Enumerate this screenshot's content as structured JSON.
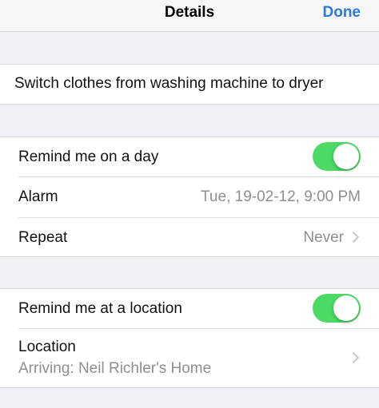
{
  "navbar": {
    "title": "Details",
    "done_label": "Done"
  },
  "task": {
    "title": "Switch clothes from washing machine to dryer"
  },
  "day_group": {
    "remind_day_label": "Remind me on a day",
    "remind_day_on": true,
    "alarm_label": "Alarm",
    "alarm_value": "Tue, 19-02-12, 9:00 PM",
    "repeat_label": "Repeat",
    "repeat_value": "Never"
  },
  "location_group": {
    "remind_location_label": "Remind me at a location",
    "remind_location_on": true,
    "location_label": "Location",
    "location_value": "Arriving: Neil Richler's Home"
  },
  "colors": {
    "accent": "#2a7ae2",
    "toggle_on": "#4cd964",
    "background": "#efeff4"
  }
}
